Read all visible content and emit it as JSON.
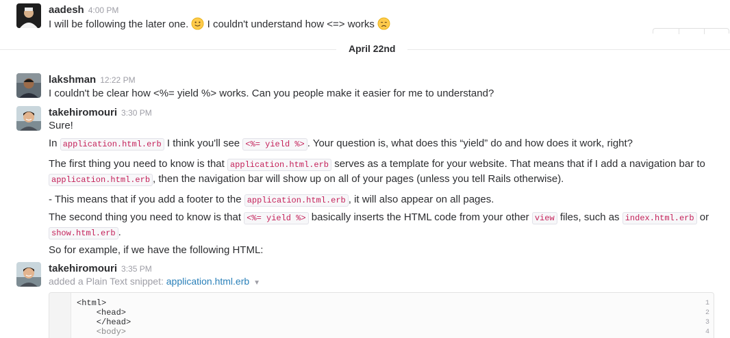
{
  "messages": {
    "m1": {
      "user": "aadesh",
      "time": "4:00 PM",
      "text_a": "I will be following the later one.",
      "text_b": "I couldn't understand how <=> works"
    },
    "day": "April 22nd",
    "m2": {
      "user": "lakshman",
      "time": "12:22 PM",
      "text": "I couldn't be clear how <%= yield %> works. Can you people make it easier for me to understand?"
    },
    "m3": {
      "user": "takehiromouri",
      "time": "3:30 PM",
      "sure": "Sure!",
      "p1_a": "In",
      "p1_code1": "application.html.erb",
      "p1_b": "I think you'll see",
      "p1_code2": "<%= yield %>",
      "p1_c": ". Your question is, what does this “yield” do and how does it work, right?",
      "p2_a": "The first thing you need to know is that",
      "p2_code1": "application.html.erb",
      "p2_b": "serves as a template for your website. That means that if I add a navigation bar to",
      "p2_code2": "application.html.erb",
      "p2_c": ", then the navigation bar will show up on all of your pages (unless you tell Rails otherwise).",
      "p3_a": "- This means that if you add a footer to the",
      "p3_code": "application.html.erb",
      "p3_b": ", it will also appear on all pages.",
      "p4_a": "The second thing you need to know is that",
      "p4_code1": "<%= yield %>",
      "p4_b": "basically inserts the HTML code from your other",
      "p4_code2": "view",
      "p4_c": "files, such as",
      "p4_code3": "index.html.erb",
      "p4_d": "or",
      "p4_code4": "show.html.erb",
      "p4_e": ".",
      "p5": "So for example, if we have the following HTML:"
    },
    "m4": {
      "user": "takehiromouri",
      "time": "3:35 PM",
      "snippet_prefix": "added a Plain Text snippet:",
      "snippet_name": "application.html.erb",
      "lines": [
        {
          "n": "1",
          "code": "<html>"
        },
        {
          "n": "2",
          "code": "    <head>"
        },
        {
          "n": "3",
          "code": "    </head>"
        },
        {
          "n": "4",
          "code": "    <body>"
        }
      ]
    }
  },
  "icons": {
    "smile": "slightly-smiling-face-icon",
    "sad": "disappointed-face-icon",
    "chevron": "chevron-down-icon"
  },
  "colors": {
    "code_text": "#c41f58",
    "link": "#2a80b9",
    "muted": "#9e9ea6"
  }
}
